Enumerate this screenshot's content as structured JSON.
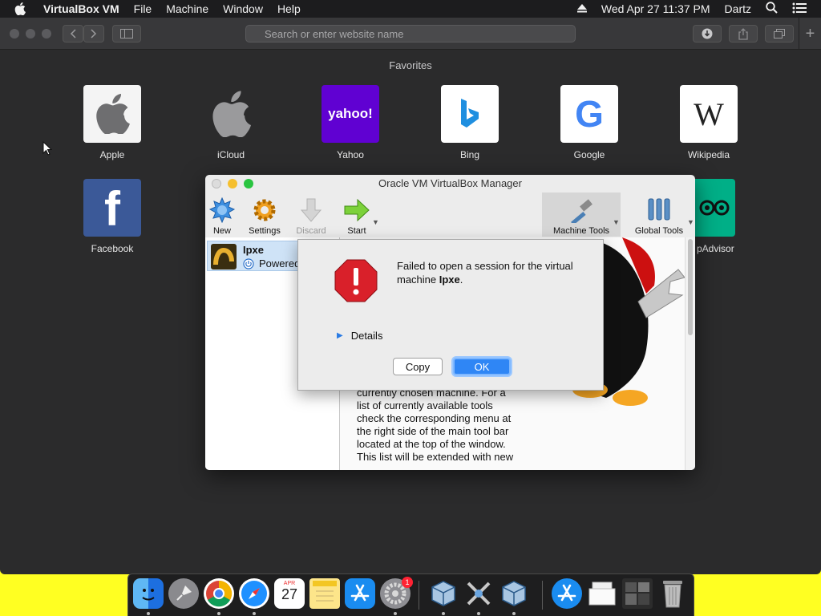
{
  "menubar": {
    "app_name": "VirtualBox VM",
    "items": [
      "File",
      "Machine",
      "Window",
      "Help"
    ],
    "datetime": "Wed Apr 27  11:37 PM",
    "user": "Dartz"
  },
  "safari": {
    "search_placeholder": "Search or enter website name",
    "favorites_title": "Favorites",
    "favorites": [
      {
        "label": "Apple",
        "icon": "apple-logo"
      },
      {
        "label": "iCloud",
        "icon": "icloud-logo"
      },
      {
        "label": "Yahoo",
        "icon": "yahoo-logo",
        "tile_text": "yahoo!"
      },
      {
        "label": "Bing",
        "icon": "bing-logo"
      },
      {
        "label": "Google",
        "icon": "google-logo",
        "tile_text": "G"
      },
      {
        "label": "Wikipedia",
        "icon": "wikipedia-logo",
        "tile_text": "W"
      },
      {
        "label": "Facebook",
        "icon": "facebook-logo",
        "tile_text": "f"
      },
      {
        "label": "pAdvisor",
        "icon": "tripadvisor-logo"
      }
    ]
  },
  "vbox": {
    "title": "Oracle VM VirtualBox Manager",
    "toolbar": {
      "new": "New",
      "settings": "Settings",
      "discard": "Discard",
      "start": "Start",
      "machine_tools": "Machine Tools",
      "global_tools": "Global Tools"
    },
    "vm": {
      "name": "Ipxe",
      "state": "Powered"
    },
    "welcome_text": "currently chosen machine. For a list of currently available tools check the corresponding menu at the right side of the main tool bar located at the top of the window. This list will be extended with new"
  },
  "dialog": {
    "message_prefix": "Failed to open a session for the virtual machine ",
    "machine_name": "Ipxe",
    "message_suffix": ".",
    "details_label": "Details",
    "copy_label": "Copy",
    "ok_label": "OK"
  },
  "dock": {
    "calendar_month": "APR",
    "calendar_day": "27",
    "badge": "1"
  }
}
